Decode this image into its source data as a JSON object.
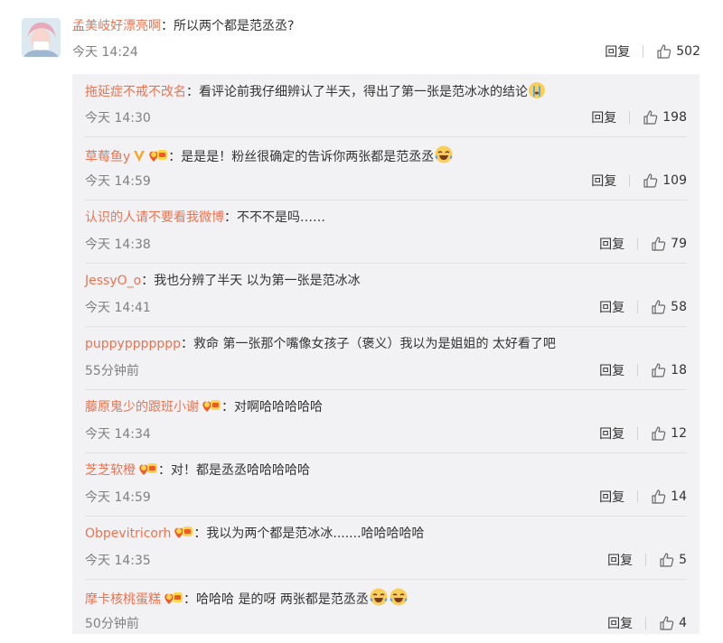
{
  "main_comment": {
    "username": "孟美岐好漂亮啊",
    "sep": "：",
    "text": "所以两个都是范丞丞?",
    "time": "今天 14:24",
    "reply_label": "回复",
    "likes": "502"
  },
  "replies": [
    {
      "username": "拖延症不戒不改名",
      "sep": "：",
      "text": "看评论前我仔细辨认了半天，得出了第一张是范冰冰的结论",
      "time": "今天 14:30",
      "reply_label": "回复",
      "likes": "198",
      "trailing_emoji": "crying-emoji-icon"
    },
    {
      "username": "草莓鱼y",
      "sep": "：",
      "text": "是是是！粉丝很确定的告诉你两张都是范丞丞",
      "time": "今天 14:59",
      "reply_label": "回复",
      "likes": "109",
      "badges": [
        "v-badge-icon",
        "fan-badge-icon"
      ],
      "trailing_emoji": "laughing-crying-emoji-icon"
    },
    {
      "username": "认识的人请不要看我微博",
      "sep": "：",
      "text": "不不不是吗……",
      "time": "今天 14:38",
      "reply_label": "回复",
      "likes": "79"
    },
    {
      "username": "JessyO_o",
      "sep": "：",
      "text": "我也分辨了半天 以为第一张是范冰冰",
      "time": "今天 14:41",
      "reply_label": "回复",
      "likes": "58"
    },
    {
      "username": "puppyppppppp",
      "sep": "：",
      "text": "救命 第一张那个嘴像女孩子（褒义）我以为是姐姐的 太好看了吧",
      "time": "55分钟前",
      "reply_label": "回复",
      "likes": "18"
    },
    {
      "username": "藤原鬼少的跟班小谢",
      "sep": "：",
      "text": "对啊哈哈哈哈哈",
      "time": "今天 14:34",
      "reply_label": "回复",
      "likes": "12",
      "badges": [
        "fan-badge-icon"
      ]
    },
    {
      "username": "芝芝软橙",
      "sep": "：",
      "text": "对！都是丞丞哈哈哈哈哈",
      "time": "今天 14:59",
      "reply_label": "回复",
      "likes": "14",
      "badges": [
        "fan-badge-icon"
      ]
    },
    {
      "username": "Obpevitricorh",
      "sep": "：",
      "text": "我以为两个都是范冰冰.......哈哈哈哈哈",
      "time": "今天 14:35",
      "reply_label": "回复",
      "likes": "5",
      "badges": [
        "fan-badge-icon"
      ]
    },
    {
      "username": "摩卡核桃蛋糕",
      "sep": "：",
      "text": "哈哈哈 是的呀 两张都是范丞丞",
      "time": "50分钟前",
      "reply_label": "回复",
      "likes": "4",
      "badges": [
        "fan-badge-icon"
      ],
      "trailing_emoji": "laughing-tears-emoji-icon-x2"
    }
  ],
  "colors": {
    "username": "#eb7350",
    "meta": "#808080",
    "reply_bg": "#f2f2f5"
  }
}
